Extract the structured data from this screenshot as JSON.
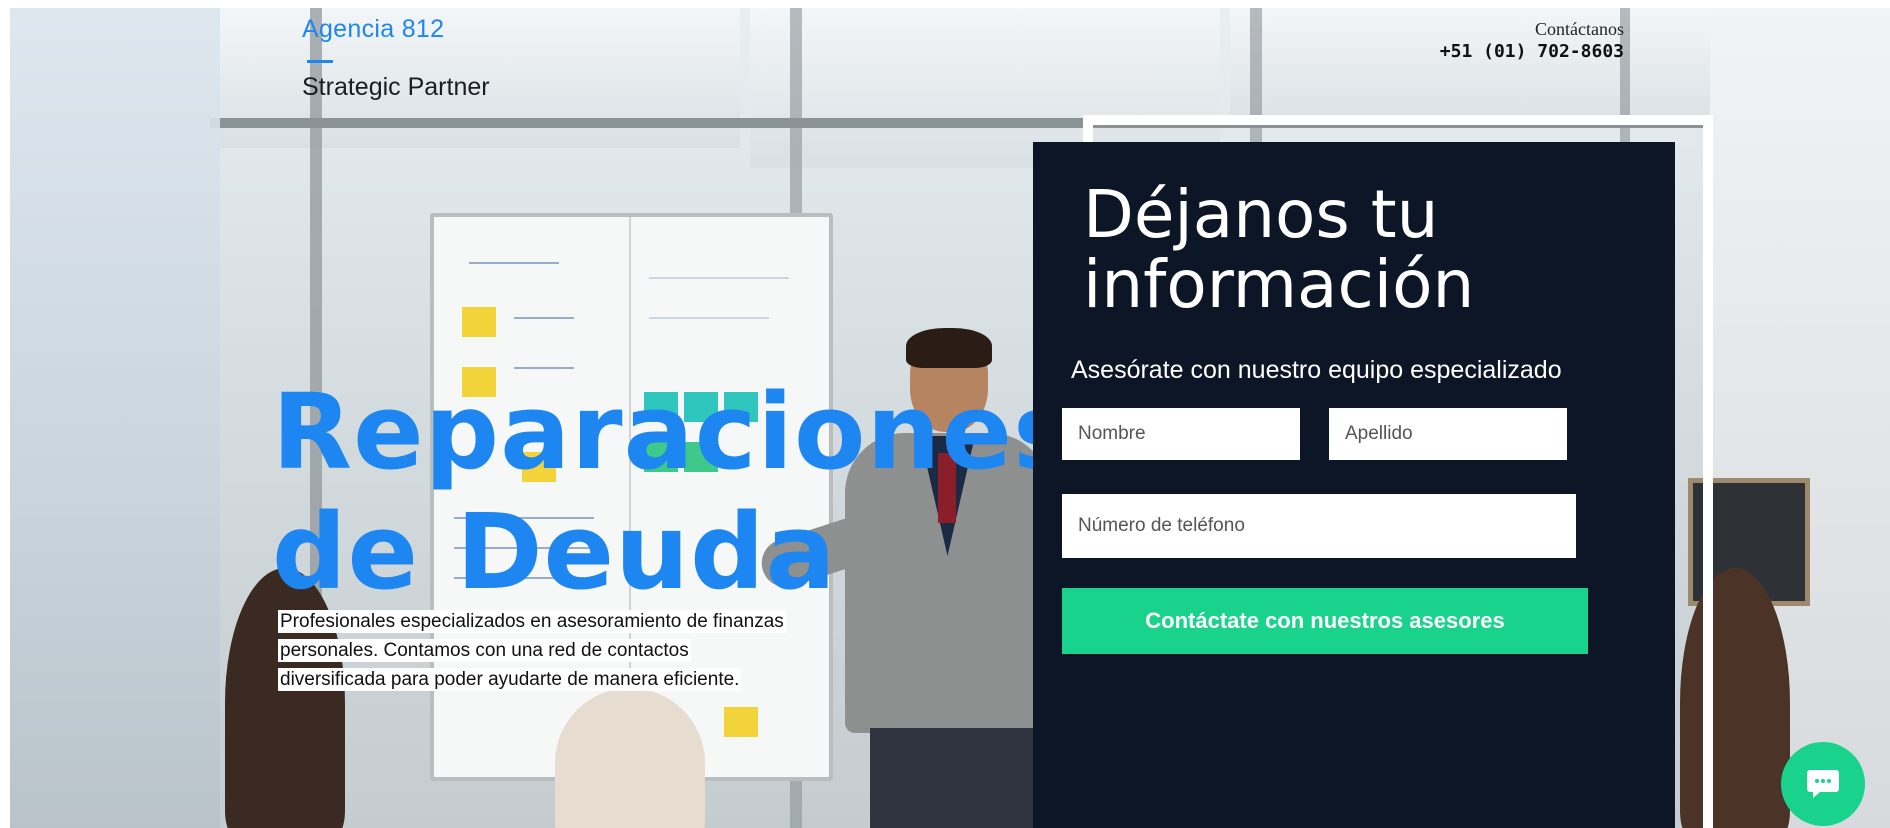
{
  "header": {
    "brand_name": "Agencia 812",
    "brand_tagline": "Strategic Partner",
    "contact_label": "Contáctanos",
    "contact_phone": "+51 (01) 702-8603"
  },
  "hero": {
    "title_line1": "Reparaciones",
    "title_line2": "de Deuda",
    "description": "Profesionales especializados en asesoramiento de finanzas personales. Contamos con una red de contactos diversificada para poder ayudarte de manera eficiente."
  },
  "form": {
    "title_line1": "Déjanos tu",
    "title_line2": "información",
    "subtitle": "Asesórate con nuestro equipo especializado",
    "first_name": {
      "value": "",
      "placeholder": "Nombre"
    },
    "last_name": {
      "value": "",
      "placeholder": "Apellido"
    },
    "phone": {
      "value": "",
      "placeholder": "Número de teléfono"
    },
    "submit_label": "Contáctate con nuestros asesores"
  },
  "chat": {
    "icon": "chat-bubble-icon"
  },
  "colors": {
    "accent_blue": "#1e86f0",
    "panel_navy": "#0c1627",
    "cta_green": "#19d38c",
    "text_dark": "#111111",
    "white": "#ffffff"
  }
}
